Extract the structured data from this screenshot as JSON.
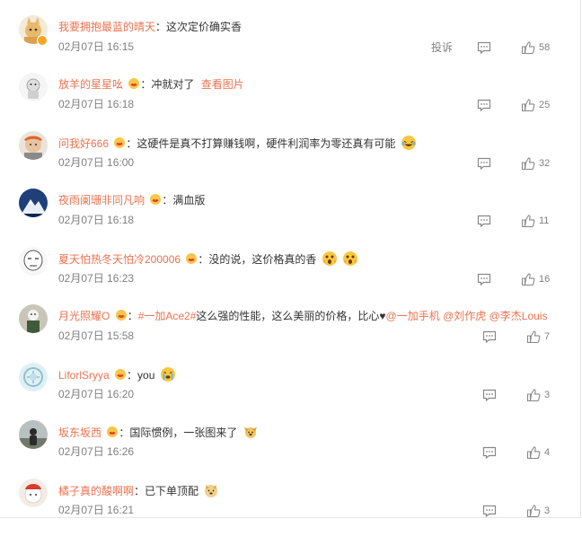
{
  "report_label": "投诉",
  "colon": "：",
  "comments": [
    {
      "user": "我要拥抱最蓝的晴天",
      "text": "这次定价确实香",
      "time": "02月07日 16:15",
      "likes": "58",
      "verified": true
    },
    {
      "user": "放羊的星星吆",
      "text": "冲就对了",
      "link": "查看图片",
      "time": "02月07日 16:18",
      "likes": "25"
    },
    {
      "user": "问我好666",
      "text": "这硬件是真不打算赚钱啊，硬件利润率为零还真有可能",
      "time": "02月07日 16:00",
      "likes": "32"
    },
    {
      "user": "夜雨阑珊非同凡响",
      "text": "满血版",
      "time": "02月07日 16:18",
      "likes": "11"
    },
    {
      "user": "夏天怕热冬天怕冷200006",
      "text": "没的说，这价格真的香",
      "time": "02月07日 16:23",
      "likes": "16"
    },
    {
      "user": "月光照耀O",
      "topic": "#一加Ace2#",
      "text": "这么强的性能，这么美丽的价格，比心",
      "mention1": "@一加手机",
      "mention2": "@刘作虎",
      "mention3": "@李杰Louis",
      "time": "02月07日 15:58",
      "likes": "7"
    },
    {
      "user": "LiforlSryya",
      "text": "you",
      "time": "02月07日 16:20",
      "likes": "3"
    },
    {
      "user": "坂东坂西",
      "text": "国际惯例，一张图来了",
      "time": "02月07日 16:26",
      "likes": "4"
    },
    {
      "user": "橘子真的酸啊啊",
      "text": "已下单顶配",
      "time": "02月07日 16:21",
      "likes": "3"
    }
  ],
  "colors": {
    "username": "#eb7350",
    "text": "#333333",
    "meta": "#808080"
  },
  "icons": [
    "comment-icon",
    "like-icon",
    "fan-medal-icon",
    "verified-badge-icon"
  ]
}
